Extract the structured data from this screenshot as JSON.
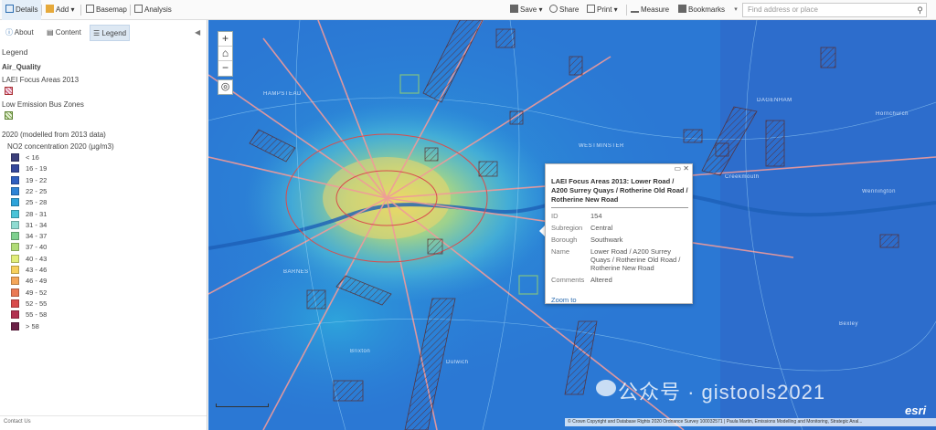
{
  "toolbar": {
    "details": "Details",
    "add": "Add",
    "basemap": "Basemap",
    "analysis": "Analysis",
    "save": "Save",
    "share": "Share",
    "print": "Print",
    "measure": "Measure",
    "bookmarks": "Bookmarks",
    "search_placeholder": "Find address or place"
  },
  "panel": {
    "tabs": [
      "About",
      "Content",
      "Legend"
    ],
    "heading": "Legend",
    "layer_title": "Air_Quality",
    "focus_areas_label": "LAEI Focus Areas 2013",
    "bus_zones_label": "Low Emission Bus Zones",
    "model_label": "2020 (modelled from 2013 data)",
    "no2_label": "NO2 concentration 2020 (µg/m3)",
    "contact": "Contact Us"
  },
  "legend_classes": [
    {
      "label": "< 16",
      "color": "#3b3f7a"
    },
    {
      "label": "16 - 19",
      "color": "#35489c"
    },
    {
      "label": "19 - 22",
      "color": "#2f5fc0"
    },
    {
      "label": "22 - 25",
      "color": "#2f84d6"
    },
    {
      "label": "25 - 28",
      "color": "#2ea3da"
    },
    {
      "label": "28 - 31",
      "color": "#49c3d8"
    },
    {
      "label": "31 - 34",
      "color": "#8fdcd2"
    },
    {
      "label": "34 - 37",
      "color": "#7fd18f"
    },
    {
      "label": "37 - 40",
      "color": "#b0dc77"
    },
    {
      "label": "40 - 43",
      "color": "#e2ee7a"
    },
    {
      "label": "43 - 46",
      "color": "#f7d05c"
    },
    {
      "label": "46 - 49",
      "color": "#f4a65a"
    },
    {
      "label": "49 - 52",
      "color": "#ea7a55"
    },
    {
      "label": "52 - 55",
      "color": "#d94c4c"
    },
    {
      "label": "55 - 58",
      "color": "#b23150"
    },
    {
      "label": "> 58",
      "color": "#6b2147"
    }
  ],
  "popup": {
    "title": "LAEI Focus Areas 2013: Lower Road / A200 Surrey Quays / Rotherine Old Road / Rotherine New Road",
    "fields": [
      {
        "label": "ID",
        "value": "154"
      },
      {
        "label": "Subregion",
        "value": "Central"
      },
      {
        "label": "Borough",
        "value": "Southwark"
      },
      {
        "label": "Name",
        "value": "Lower Road / A200 Surrey Quays / Rotherine Old Road / Rotherine New Road"
      },
      {
        "label": "Comments",
        "value": "Altered"
      }
    ],
    "zoom_to": "Zoom to"
  },
  "map": {
    "places": [
      "HAMPSTEAD",
      "WESTMINSTER",
      "BARNES",
      "DAGENHAM",
      "Creekmouth",
      "Wennington",
      "Brixton",
      "Dulwich",
      "Bexley",
      "Hornchurch"
    ],
    "attribution": "© Crown Copyright and Database Rights 2020 Ordnance Survey 100032571 | Paula Martin, Emissions Modelling and Monitoring, Strategic Anal...",
    "logo": "esri",
    "watermark": "公众号 · gistools2021"
  }
}
